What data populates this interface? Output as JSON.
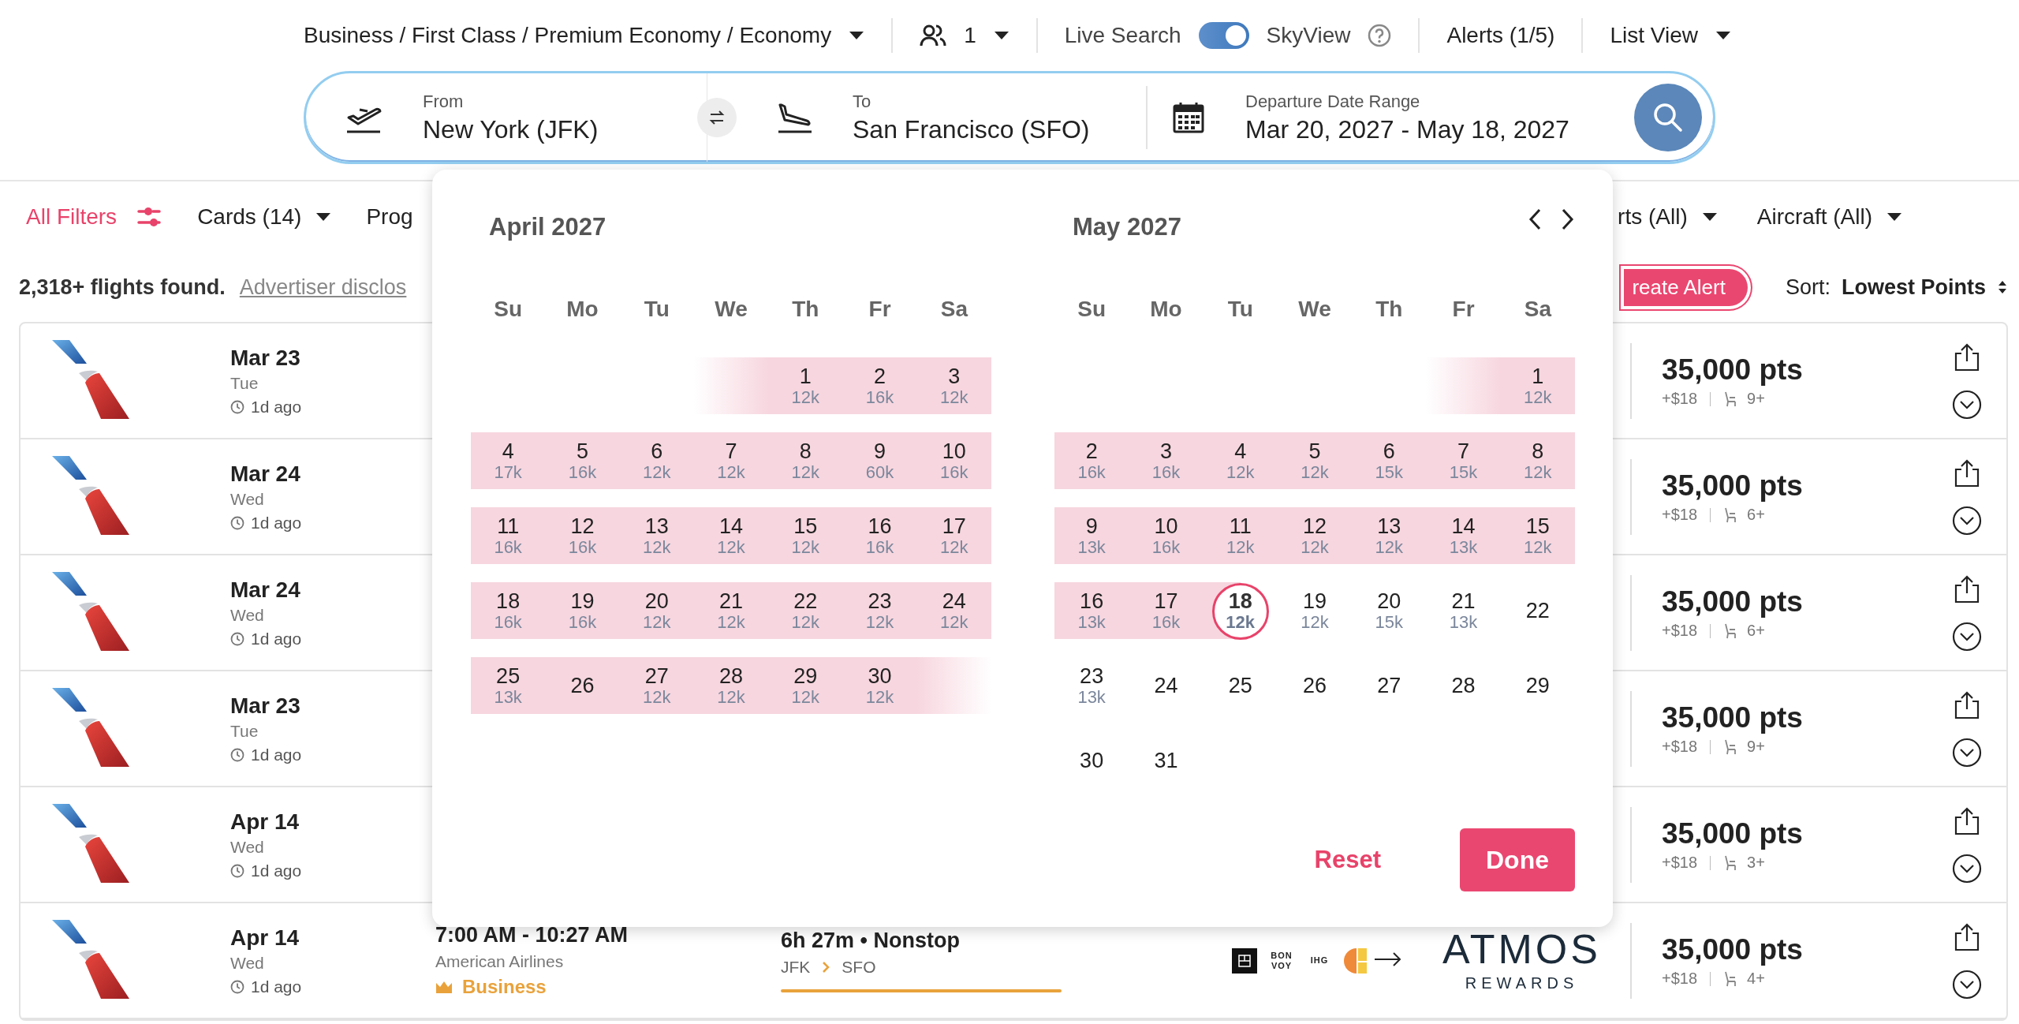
{
  "header": {
    "cabin": {
      "label": "Business / First Class / Premium Economy / Economy"
    },
    "passengers": {
      "count": "1"
    },
    "live_search": {
      "label": "Live Search",
      "on": true
    },
    "skyview": {
      "label": "SkyView"
    },
    "alerts": {
      "label": "Alerts (1/5)"
    },
    "view": {
      "label": "List View"
    }
  },
  "search": {
    "from": {
      "label": "From",
      "value": "New York (JFK)"
    },
    "to": {
      "label": "To",
      "value": "San Francisco (SFO)"
    },
    "dates": {
      "label": "Departure Date Range",
      "value": "Mar 20, 2027 - May 18, 2027"
    }
  },
  "filters": {
    "all_filters": "All Filters",
    "left_dropdowns": [
      {
        "label": "Cards (14)",
        "caret": true
      },
      {
        "label": "Prog",
        "caret": false
      }
    ],
    "right_dropdowns": [
      {
        "label": "rts (All)",
        "caret": true
      },
      {
        "label": "Aircraft (All)",
        "caret": true
      }
    ]
  },
  "results": {
    "count": "2,318+ flights found.",
    "disclosure_link": "Advertiser disclos",
    "alert_button": "reate Alert",
    "sort": {
      "label": "Sort:",
      "value": "Lowest Points"
    }
  },
  "flights": [
    {
      "date": "Mar 23",
      "weekday": "Tue",
      "age": "1d ago",
      "points": "35,000 pts",
      "fee": "+$18",
      "seats": "9+"
    },
    {
      "date": "Mar 24",
      "weekday": "Wed",
      "age": "1d ago",
      "points": "35,000 pts",
      "fee": "+$18",
      "seats": "6+"
    },
    {
      "date": "Mar 24",
      "weekday": "Wed",
      "age": "1d ago",
      "points": "35,000 pts",
      "fee": "+$18",
      "seats": "6+"
    },
    {
      "date": "Mar 23",
      "weekday": "Tue",
      "age": "1d ago",
      "points": "35,000 pts",
      "fee": "+$18",
      "seats": "9+"
    },
    {
      "date": "Apr 14",
      "weekday": "Wed",
      "age": "1d ago",
      "points": "35,000 pts",
      "fee": "+$18",
      "seats": "3+"
    },
    {
      "date": "Apr 14",
      "weekday": "Wed",
      "age": "1d ago",
      "times": "7:00 AM - 10:27 AM",
      "airline": "American Airlines",
      "cabin": "Business",
      "duration": "6h 27m • Nonstop",
      "origin": "JFK",
      "destination": "SFO",
      "partners": [
        {
          "kind": "square"
        },
        {
          "kind": "wordmark",
          "text": "BON VOY"
        },
        {
          "kind": "wordmark",
          "text": "IHG"
        },
        {
          "kind": "half_circle"
        }
      ],
      "program": {
        "name": "ATMOS",
        "tagline": "REWARDS"
      },
      "points": "35,000 pts",
      "fee": "+$18",
      "seats": "4+"
    }
  ],
  "calendar": {
    "months": [
      {
        "title": "April 2027",
        "weekdays": [
          "Su",
          "Mo",
          "Tu",
          "We",
          "Th",
          "Fr",
          "Sa"
        ],
        "days": [
          {
            "kind": "blank",
            "in_range": false
          },
          {
            "kind": "blank",
            "in_range": false
          },
          {
            "kind": "blank",
            "in_range": false
          },
          {
            "kind": "blank",
            "in_range": true
          },
          {
            "kind": "day",
            "day": "1",
            "price": "12k",
            "in_range": true,
            "selected": false
          },
          {
            "kind": "day",
            "day": "2",
            "price": "16k",
            "in_range": true,
            "selected": false
          },
          {
            "kind": "day",
            "day": "3",
            "price": "12k",
            "in_range": true,
            "selected": false
          },
          {
            "kind": "day",
            "day": "4",
            "price": "17k",
            "in_range": true,
            "selected": false
          },
          {
            "kind": "day",
            "day": "5",
            "price": "16k",
            "in_range": true,
            "selected": false
          },
          {
            "kind": "day",
            "day": "6",
            "price": "12k",
            "in_range": true,
            "selected": false
          },
          {
            "kind": "day",
            "day": "7",
            "price": "12k",
            "in_range": true,
            "selected": false
          },
          {
            "kind": "day",
            "day": "8",
            "price": "12k",
            "in_range": true,
            "selected": false
          },
          {
            "kind": "day",
            "day": "9",
            "price": "60k",
            "in_range": true,
            "selected": false
          },
          {
            "kind": "day",
            "day": "10",
            "price": "16k",
            "in_range": true,
            "selected": false
          },
          {
            "kind": "day",
            "day": "11",
            "price": "16k",
            "in_range": true,
            "selected": false
          },
          {
            "kind": "day",
            "day": "12",
            "price": "16k",
            "in_range": true,
            "selected": false
          },
          {
            "kind": "day",
            "day": "13",
            "price": "12k",
            "in_range": true,
            "selected": false
          },
          {
            "kind": "day",
            "day": "14",
            "price": "12k",
            "in_range": true,
            "selected": false
          },
          {
            "kind": "day",
            "day": "15",
            "price": "12k",
            "in_range": true,
            "selected": false
          },
          {
            "kind": "day",
            "day": "16",
            "price": "16k",
            "in_range": true,
            "selected": false
          },
          {
            "kind": "day",
            "day": "17",
            "price": "12k",
            "in_range": true,
            "selected": false
          },
          {
            "kind": "day",
            "day": "18",
            "price": "16k",
            "in_range": true,
            "selected": false
          },
          {
            "kind": "day",
            "day": "19",
            "price": "16k",
            "in_range": true,
            "selected": false
          },
          {
            "kind": "day",
            "day": "20",
            "price": "12k",
            "in_range": true,
            "selected": false
          },
          {
            "kind": "day",
            "day": "21",
            "price": "12k",
            "in_range": true,
            "selected": false
          },
          {
            "kind": "day",
            "day": "22",
            "price": "12k",
            "in_range": true,
            "selected": false
          },
          {
            "kind": "day",
            "day": "23",
            "price": "12k",
            "in_range": true,
            "selected": false
          },
          {
            "kind": "day",
            "day": "24",
            "price": "12k",
            "in_range": true,
            "selected": false
          },
          {
            "kind": "day",
            "day": "25",
            "price": "13k",
            "in_range": true,
            "selected": false
          },
          {
            "kind": "day",
            "day": "26",
            "in_range": true,
            "selected": false
          },
          {
            "kind": "day",
            "day": "27",
            "price": "12k",
            "in_range": true,
            "selected": false
          },
          {
            "kind": "day",
            "day": "28",
            "price": "12k",
            "in_range": true,
            "selected": false
          },
          {
            "kind": "day",
            "day": "29",
            "price": "12k",
            "in_range": true,
            "selected": false
          },
          {
            "kind": "day",
            "day": "30",
            "price": "12k",
            "in_range": true,
            "selected": false
          },
          {
            "kind": "blank",
            "in_range": true
          }
        ]
      },
      {
        "title": "May 2027",
        "weekdays": [
          "Su",
          "Mo",
          "Tu",
          "We",
          "Th",
          "Fr",
          "Sa"
        ],
        "days": [
          {
            "kind": "blank",
            "in_range": false
          },
          {
            "kind": "blank",
            "in_range": false
          },
          {
            "kind": "blank",
            "in_range": false
          },
          {
            "kind": "blank",
            "in_range": false
          },
          {
            "kind": "blank",
            "in_range": false
          },
          {
            "kind": "blank",
            "in_range": true
          },
          {
            "kind": "day",
            "day": "1",
            "price": "12k",
            "in_range": true,
            "selected": false
          },
          {
            "kind": "day",
            "day": "2",
            "price": "16k",
            "in_range": true,
            "selected": false
          },
          {
            "kind": "day",
            "day": "3",
            "price": "16k",
            "in_range": true,
            "selected": false
          },
          {
            "kind": "day",
            "day": "4",
            "price": "12k",
            "in_range": true,
            "selected": false
          },
          {
            "kind": "day",
            "day": "5",
            "price": "12k",
            "in_range": true,
            "selected": false
          },
          {
            "kind": "day",
            "day": "6",
            "price": "15k",
            "in_range": true,
            "selected": false
          },
          {
            "kind": "day",
            "day": "7",
            "price": "15k",
            "in_range": true,
            "selected": false
          },
          {
            "kind": "day",
            "day": "8",
            "price": "12k",
            "in_range": true,
            "selected": false
          },
          {
            "kind": "day",
            "day": "9",
            "price": "13k",
            "in_range": true,
            "selected": false
          },
          {
            "kind": "day",
            "day": "10",
            "price": "16k",
            "in_range": true,
            "selected": false
          },
          {
            "kind": "day",
            "day": "11",
            "price": "12k",
            "in_range": true,
            "selected": false
          },
          {
            "kind": "day",
            "day": "12",
            "price": "12k",
            "in_range": true,
            "selected": false
          },
          {
            "kind": "day",
            "day": "13",
            "price": "12k",
            "in_range": true,
            "selected": false
          },
          {
            "kind": "day",
            "day": "14",
            "price": "13k",
            "in_range": true,
            "selected": false
          },
          {
            "kind": "day",
            "day": "15",
            "price": "12k",
            "in_range": true,
            "selected": false
          },
          {
            "kind": "day",
            "day": "16",
            "price": "13k",
            "in_range": true,
            "selected": false
          },
          {
            "kind": "day",
            "day": "17",
            "price": "16k",
            "in_range": true,
            "selected": false
          },
          {
            "kind": "day",
            "day": "18",
            "price": "12k",
            "in_range": true,
            "selected": true
          },
          {
            "kind": "day",
            "day": "19",
            "price": "12k",
            "in_range": false,
            "selected": false
          },
          {
            "kind": "day",
            "day": "20",
            "price": "15k",
            "in_range": false,
            "selected": false
          },
          {
            "kind": "day",
            "day": "21",
            "price": "13k",
            "in_range": false,
            "selected": false
          },
          {
            "kind": "day",
            "day": "22",
            "in_range": false,
            "selected": false
          },
          {
            "kind": "day",
            "day": "23",
            "price": "13k",
            "in_range": false,
            "selected": false
          },
          {
            "kind": "day",
            "day": "24",
            "in_range": false,
            "selected": false
          },
          {
            "kind": "day",
            "day": "25",
            "in_range": false,
            "selected": false
          },
          {
            "kind": "day",
            "day": "26",
            "in_range": false,
            "selected": false
          },
          {
            "kind": "day",
            "day": "27",
            "in_range": false,
            "selected": false
          },
          {
            "kind": "day",
            "day": "28",
            "in_range": false,
            "selected": false
          },
          {
            "kind": "day",
            "day": "29",
            "in_range": false,
            "selected": false
          },
          {
            "kind": "day",
            "day": "30",
            "in_range": false,
            "selected": false
          },
          {
            "kind": "day",
            "day": "31",
            "in_range": false,
            "selected": false
          }
        ]
      }
    ],
    "reset": "Reset",
    "done": "Done"
  }
}
